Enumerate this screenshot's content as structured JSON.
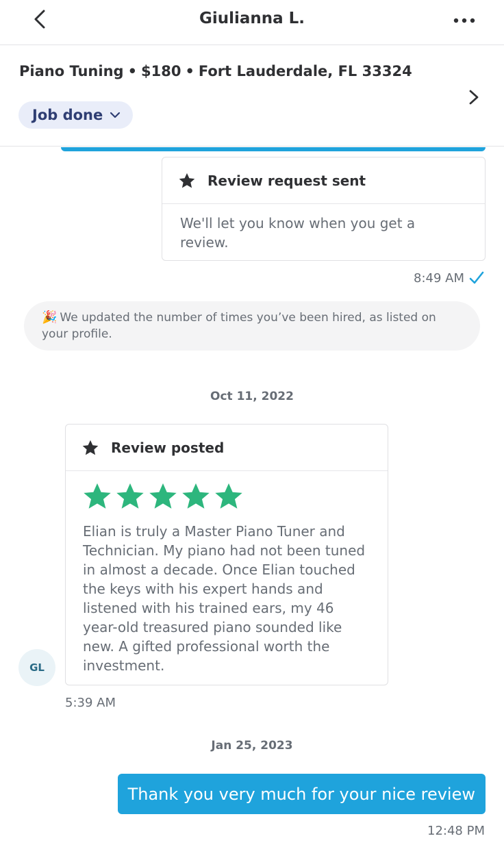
{
  "header": {
    "contact_name": "Giulianna L."
  },
  "job": {
    "service": "Piano Tuning",
    "price": "$180",
    "location": "Fort Lauderdale, FL 33324",
    "separator": "•",
    "status": "Job done"
  },
  "messages": {
    "review_request": {
      "title": "Review request sent",
      "body": "We'll let you know when you get a review.",
      "time": "8:49 AM"
    },
    "notice": {
      "emoji": "🎉",
      "text": "We updated the number of times you’ve been hired, as listed on your profile."
    },
    "date_1": "Oct 11, 2022",
    "review_posted": {
      "title": "Review posted",
      "rating": 5,
      "text": "Elian is truly a Master Piano Tuner and Technician. My piano had not been tuned in almost a decade. Once Elian touched the keys with his expert hands and listened with his trained ears, my 46 year-old treasured piano sounded like new. A gifted professional worth the investment.",
      "avatar_initials": "GL",
      "time": "5:39 AM"
    },
    "date_2": "Jan 25, 2023",
    "reply": {
      "text": "Thank you very much for your nice review",
      "time": "12:48 PM"
    }
  },
  "colors": {
    "accent_blue": "#1fa3dc",
    "star_green": "#2db67d",
    "pill_bg": "#e9edf9",
    "pill_text": "#2f3e73"
  },
  "icons": {
    "back": "chevron-left-icon",
    "more": "more-horizontal-icon",
    "dropdown": "chevron-down-icon",
    "details": "chevron-right-icon",
    "card_star": "star-icon",
    "delivered": "check-icon"
  }
}
